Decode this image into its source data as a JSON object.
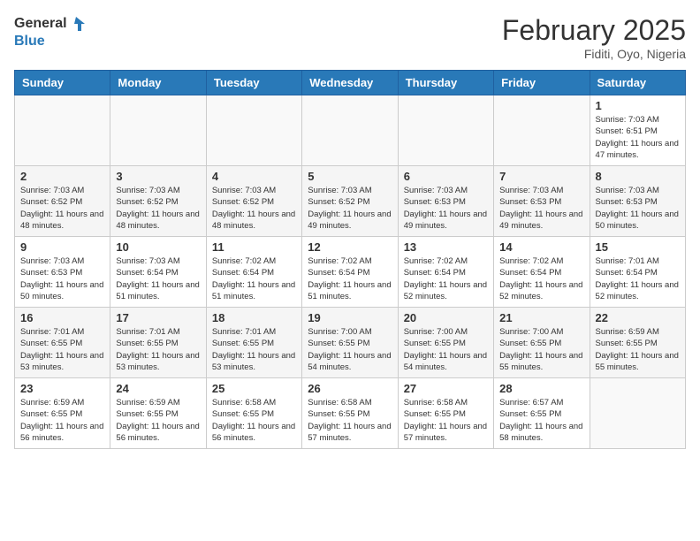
{
  "header": {
    "logo_general": "General",
    "logo_blue": "Blue",
    "month_title": "February 2025",
    "location": "Fiditi, Oyo, Nigeria"
  },
  "weekdays": [
    "Sunday",
    "Monday",
    "Tuesday",
    "Wednesday",
    "Thursday",
    "Friday",
    "Saturday"
  ],
  "weeks": [
    [
      {
        "day": "",
        "info": ""
      },
      {
        "day": "",
        "info": ""
      },
      {
        "day": "",
        "info": ""
      },
      {
        "day": "",
        "info": ""
      },
      {
        "day": "",
        "info": ""
      },
      {
        "day": "",
        "info": ""
      },
      {
        "day": "1",
        "info": "Sunrise: 7:03 AM\nSunset: 6:51 PM\nDaylight: 11 hours and 47 minutes."
      }
    ],
    [
      {
        "day": "2",
        "info": "Sunrise: 7:03 AM\nSunset: 6:52 PM\nDaylight: 11 hours and 48 minutes."
      },
      {
        "day": "3",
        "info": "Sunrise: 7:03 AM\nSunset: 6:52 PM\nDaylight: 11 hours and 48 minutes."
      },
      {
        "day": "4",
        "info": "Sunrise: 7:03 AM\nSunset: 6:52 PM\nDaylight: 11 hours and 48 minutes."
      },
      {
        "day": "5",
        "info": "Sunrise: 7:03 AM\nSunset: 6:52 PM\nDaylight: 11 hours and 49 minutes."
      },
      {
        "day": "6",
        "info": "Sunrise: 7:03 AM\nSunset: 6:53 PM\nDaylight: 11 hours and 49 minutes."
      },
      {
        "day": "7",
        "info": "Sunrise: 7:03 AM\nSunset: 6:53 PM\nDaylight: 11 hours and 49 minutes."
      },
      {
        "day": "8",
        "info": "Sunrise: 7:03 AM\nSunset: 6:53 PM\nDaylight: 11 hours and 50 minutes."
      }
    ],
    [
      {
        "day": "9",
        "info": "Sunrise: 7:03 AM\nSunset: 6:53 PM\nDaylight: 11 hours and 50 minutes."
      },
      {
        "day": "10",
        "info": "Sunrise: 7:03 AM\nSunset: 6:54 PM\nDaylight: 11 hours and 51 minutes."
      },
      {
        "day": "11",
        "info": "Sunrise: 7:02 AM\nSunset: 6:54 PM\nDaylight: 11 hours and 51 minutes."
      },
      {
        "day": "12",
        "info": "Sunrise: 7:02 AM\nSunset: 6:54 PM\nDaylight: 11 hours and 51 minutes."
      },
      {
        "day": "13",
        "info": "Sunrise: 7:02 AM\nSunset: 6:54 PM\nDaylight: 11 hours and 52 minutes."
      },
      {
        "day": "14",
        "info": "Sunrise: 7:02 AM\nSunset: 6:54 PM\nDaylight: 11 hours and 52 minutes."
      },
      {
        "day": "15",
        "info": "Sunrise: 7:01 AM\nSunset: 6:54 PM\nDaylight: 11 hours and 52 minutes."
      }
    ],
    [
      {
        "day": "16",
        "info": "Sunrise: 7:01 AM\nSunset: 6:55 PM\nDaylight: 11 hours and 53 minutes."
      },
      {
        "day": "17",
        "info": "Sunrise: 7:01 AM\nSunset: 6:55 PM\nDaylight: 11 hours and 53 minutes."
      },
      {
        "day": "18",
        "info": "Sunrise: 7:01 AM\nSunset: 6:55 PM\nDaylight: 11 hours and 53 minutes."
      },
      {
        "day": "19",
        "info": "Sunrise: 7:00 AM\nSunset: 6:55 PM\nDaylight: 11 hours and 54 minutes."
      },
      {
        "day": "20",
        "info": "Sunrise: 7:00 AM\nSunset: 6:55 PM\nDaylight: 11 hours and 54 minutes."
      },
      {
        "day": "21",
        "info": "Sunrise: 7:00 AM\nSunset: 6:55 PM\nDaylight: 11 hours and 55 minutes."
      },
      {
        "day": "22",
        "info": "Sunrise: 6:59 AM\nSunset: 6:55 PM\nDaylight: 11 hours and 55 minutes."
      }
    ],
    [
      {
        "day": "23",
        "info": "Sunrise: 6:59 AM\nSunset: 6:55 PM\nDaylight: 11 hours and 56 minutes."
      },
      {
        "day": "24",
        "info": "Sunrise: 6:59 AM\nSunset: 6:55 PM\nDaylight: 11 hours and 56 minutes."
      },
      {
        "day": "25",
        "info": "Sunrise: 6:58 AM\nSunset: 6:55 PM\nDaylight: 11 hours and 56 minutes."
      },
      {
        "day": "26",
        "info": "Sunrise: 6:58 AM\nSunset: 6:55 PM\nDaylight: 11 hours and 57 minutes."
      },
      {
        "day": "27",
        "info": "Sunrise: 6:58 AM\nSunset: 6:55 PM\nDaylight: 11 hours and 57 minutes."
      },
      {
        "day": "28",
        "info": "Sunrise: 6:57 AM\nSunset: 6:55 PM\nDaylight: 11 hours and 58 minutes."
      },
      {
        "day": "",
        "info": ""
      }
    ]
  ]
}
